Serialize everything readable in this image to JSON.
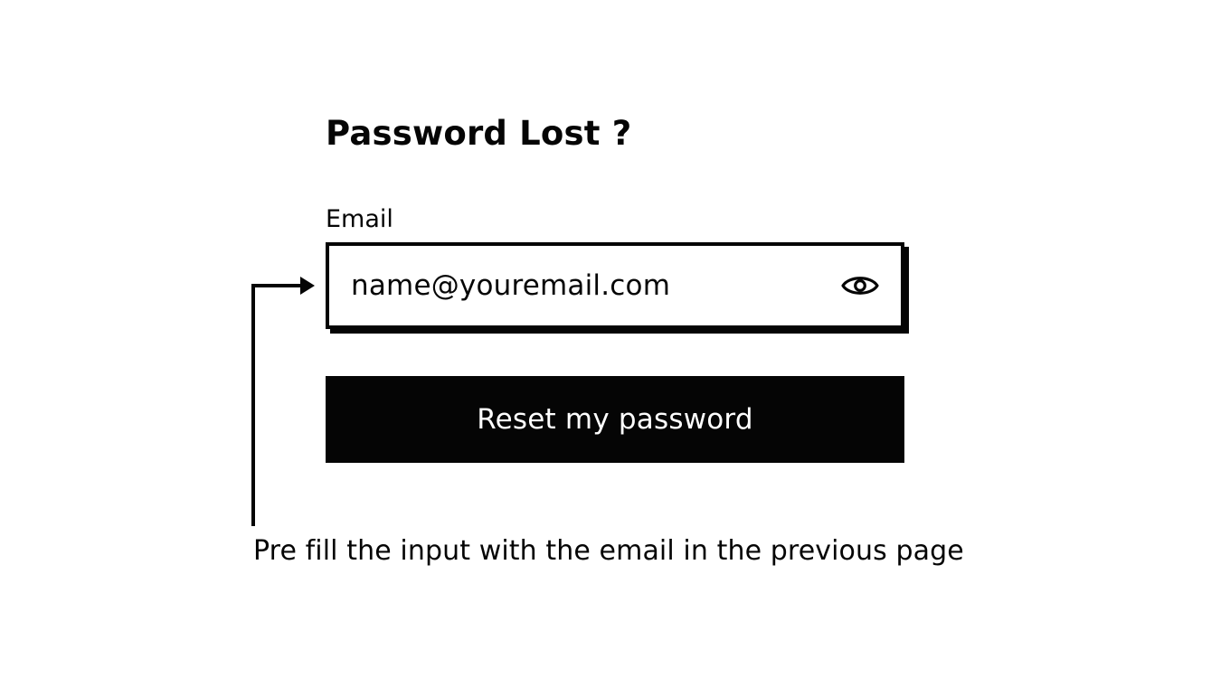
{
  "form": {
    "title": "Password Lost ?",
    "email_label": "Email",
    "email_value": "name@youremail.com",
    "visibility_icon": "eye-icon",
    "submit_label": "Reset my password"
  },
  "annotation": {
    "note": "Pre fill the input with the email in the previous page"
  },
  "colors": {
    "ink": "#050505",
    "background": "#ffffff",
    "button_text": "#ffffff"
  }
}
